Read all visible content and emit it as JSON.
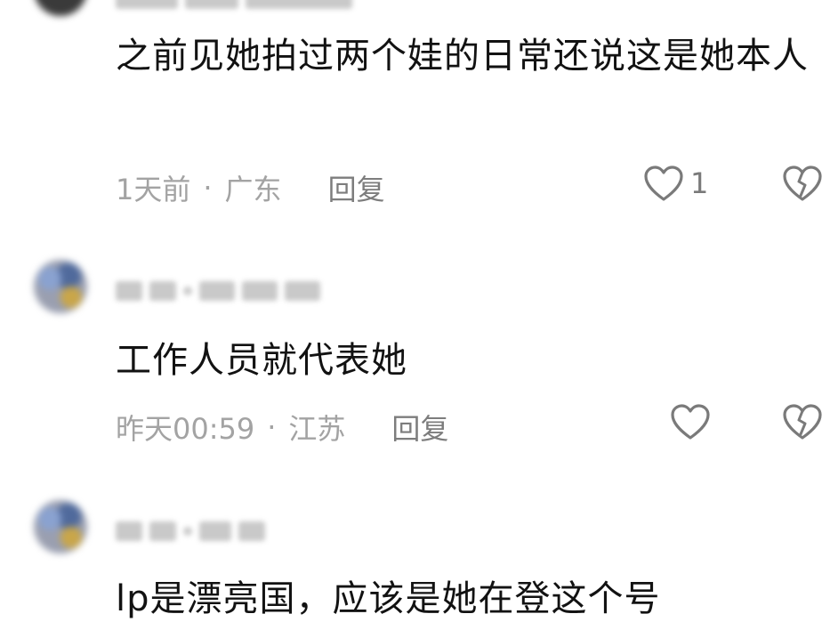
{
  "comments": [
    {
      "text": "之前见她拍过两个娃的日常还说这是她本人",
      "time": "1天前",
      "separator": "·",
      "location": "广东",
      "reply_label": "回复",
      "like_count": "1"
    },
    {
      "text": "工作人员就代表她",
      "time": "昨天00:59",
      "separator": "·",
      "location": "江苏",
      "reply_label": "回复",
      "like_count": ""
    },
    {
      "text": "lp是漂亮国，应该是她在登这个号"
    }
  ],
  "icons": {
    "like": "heart-outline-icon",
    "dislike": "broken-heart-icon"
  },
  "colors": {
    "text": "#121212",
    "meta": "#a3a3a3",
    "icon": "#7a7a7a"
  }
}
